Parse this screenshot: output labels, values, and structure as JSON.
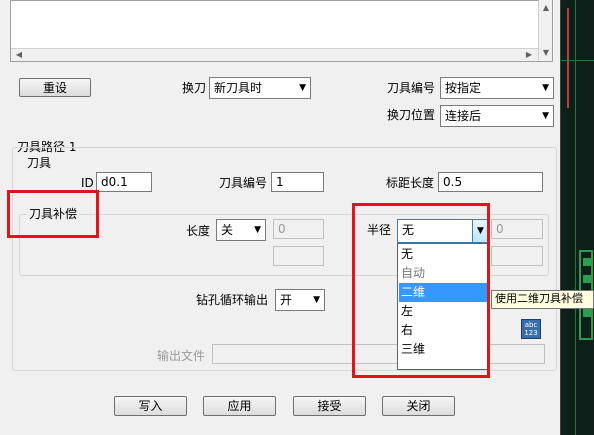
{
  "buttons": {
    "reset": "重设",
    "write": "写入",
    "apply": "应用",
    "accept": "接受",
    "close": "关闭"
  },
  "toolchange": {
    "label": "换刀",
    "value": "新刀具时",
    "tool_number_label": "刀具编号",
    "tool_number_value": "按指定",
    "position_label": "换刀位置",
    "position_value": "连接后"
  },
  "toolpath": {
    "title": "刀具路径 1"
  },
  "tool": {
    "group_label": "刀具",
    "id_label": "ID",
    "id_value": "d0.1",
    "number_label": "刀具编号",
    "number_value": "1",
    "gauge_label": "标距长度",
    "gauge_value": "0.5"
  },
  "compensation": {
    "group_label": "刀具补偿",
    "length_label": "长度",
    "length_value": "关",
    "length_field": "0",
    "radius_label": "半径",
    "radius_value": "无",
    "radius_field": "0",
    "options": [
      "无",
      "自动",
      "二维",
      "左",
      "右",
      "三维"
    ],
    "selected_option": "二维",
    "tooltip": "使用二维刀具补偿"
  },
  "drill": {
    "label": "钻孔循环输出",
    "value": "开"
  },
  "output": {
    "label": "输出文件",
    "value": ""
  },
  "icons": {
    "calculator": "abc\n123"
  },
  "colors": {
    "highlight": "#e1141b",
    "selection": "#3399ff"
  }
}
